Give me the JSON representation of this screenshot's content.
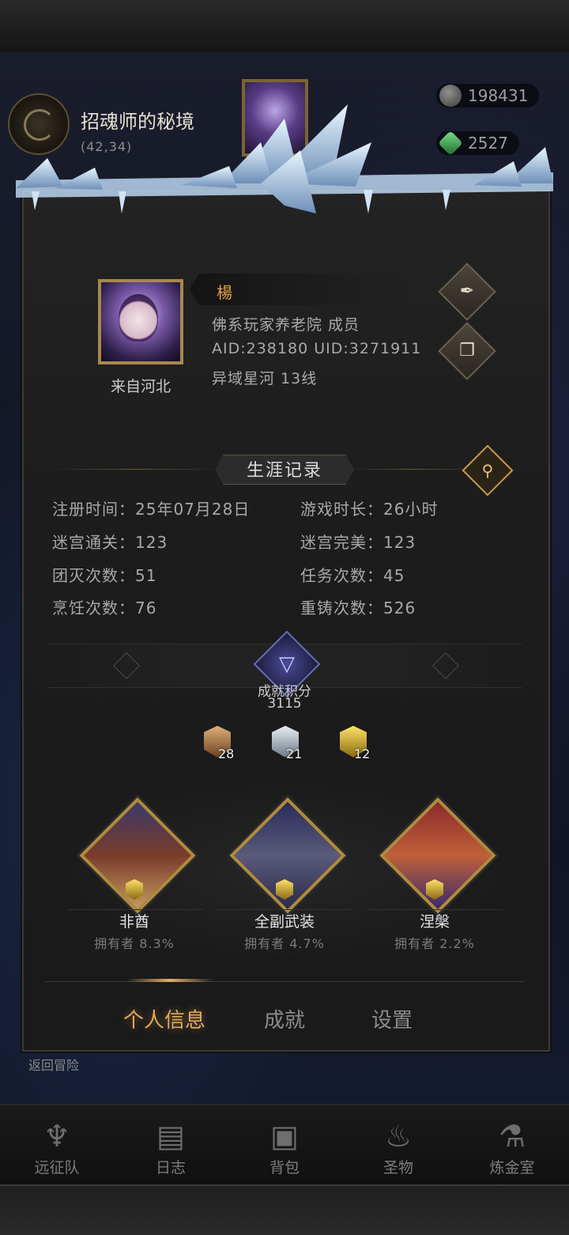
{
  "location": {
    "name": "招魂师的秘境",
    "coords": "(42,34)"
  },
  "currency": [
    {
      "icon": "stone-icon",
      "value": "198431"
    },
    {
      "icon": "gem-icon",
      "value": "2527"
    }
  ],
  "profile": {
    "name": "楊",
    "origin": "来自河北",
    "guild": "佛系玩家养老院  成员",
    "ids": "AID:238180 UID:3271911",
    "server": "异域星河  13线",
    "edit_icon": "quill-icon",
    "copy_icon": "copy-icon"
  },
  "career": {
    "title": "生涯记录",
    "search_icon": "magnifier-icon",
    "stats": [
      "注册时间：25年07月28日",
      "游戏时长：26小时",
      "迷宫通关：123",
      "迷宫完美：123",
      "团灭次数：51",
      "任务次数：45",
      "烹饪次数：76",
      "重铸次数：526"
    ]
  },
  "achievement": {
    "label": "成就积分",
    "value": "3115",
    "medals": [
      {
        "tier": "bronze",
        "count": "28"
      },
      {
        "tier": "silver",
        "count": "21"
      },
      {
        "tier": "gold",
        "count": "12"
      }
    ],
    "featured": [
      {
        "name": "非酋",
        "owners": "拥有者 8.3%"
      },
      {
        "name": "全副武装",
        "owners": "拥有者 4.7%"
      },
      {
        "name": "涅槃",
        "owners": "拥有者 2.2%"
      }
    ]
  },
  "tabs": [
    "个人信息",
    "成就",
    "设置"
  ],
  "active_tab": "个人信息",
  "return_label": "返回冒险",
  "bottom_nav": [
    {
      "label": "远征队",
      "icon": "horned-helmet-icon"
    },
    {
      "label": "日志",
      "icon": "scroll-icon"
    },
    {
      "label": "背包",
      "icon": "backpack-icon"
    },
    {
      "label": "圣物",
      "icon": "brazier-icon"
    },
    {
      "label": "炼金室",
      "icon": "alchemy-icon"
    }
  ],
  "colors": {
    "accent": "#e2a85a",
    "name": "#e6a24a",
    "frame_gold": "#b18b3e"
  }
}
